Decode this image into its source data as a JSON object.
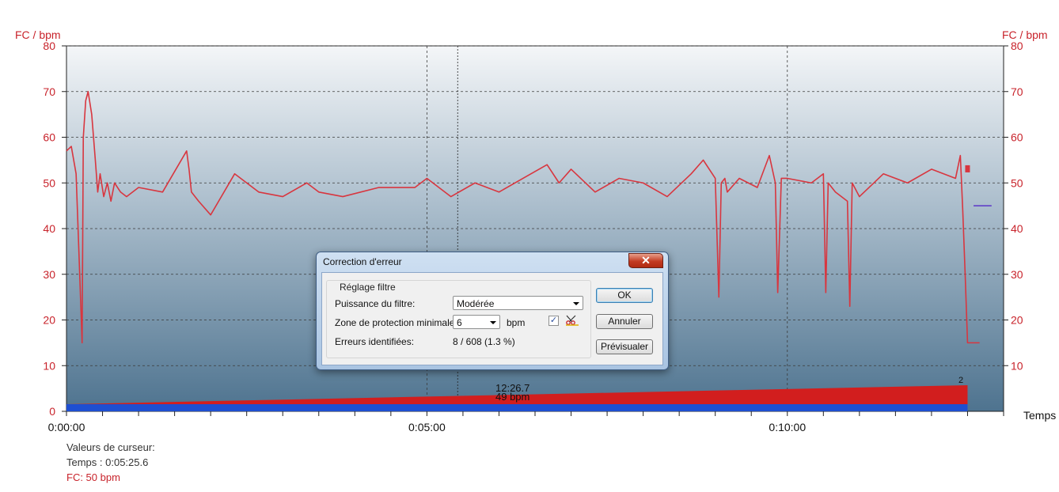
{
  "chart_data": {
    "type": "line",
    "y_axis_label_left": "FC / bpm",
    "y_axis_label_right": "FC / bpm",
    "x_axis_label": "Temps",
    "ylim": [
      0,
      80
    ],
    "y_ticks": [
      0,
      10,
      20,
      30,
      40,
      50,
      60,
      70,
      80
    ],
    "y_ticks_right": [
      10,
      20,
      30,
      40,
      50,
      60,
      70,
      80
    ],
    "x_tick_labels": [
      "0:00:00",
      "0:05:00",
      "0:10:00"
    ],
    "x_tick_seconds": [
      0,
      300,
      600
    ],
    "xlim_seconds": [
      0,
      780
    ],
    "grid": true,
    "series": [
      {
        "color": "#d8363f",
        "x_seconds": [
          0,
          4,
          8,
          11,
          13,
          14,
          16,
          18,
          21,
          24,
          26,
          28,
          31,
          34,
          37,
          40,
          45,
          50,
          60,
          80,
          100,
          102,
          104,
          110,
          120,
          140,
          160,
          180,
          200,
          210,
          230,
          260,
          290,
          300,
          320,
          340,
          360,
          380,
          400,
          410,
          420,
          440,
          460,
          480,
          500,
          520,
          530,
          540,
          543,
          545,
          548,
          550,
          560,
          575,
          585,
          590,
          592,
          595,
          600,
          620,
          630,
          632,
          634,
          640,
          650,
          652,
          654,
          660,
          680,
          700,
          720,
          740,
          744,
          746,
          748,
          750,
          755,
          760
        ],
        "values": [
          57,
          58,
          52,
          30,
          15,
          60,
          68,
          70,
          65,
          55,
          48,
          52,
          47,
          50,
          46,
          50,
          48,
          47,
          49,
          48,
          57,
          53,
          48,
          46,
          43,
          52,
          48,
          47,
          50,
          48,
          47,
          49,
          49,
          51,
          47,
          50,
          48,
          51,
          54,
          50,
          53,
          48,
          51,
          50,
          47,
          52,
          55,
          51,
          25,
          50,
          51,
          48,
          51,
          49,
          56,
          50,
          26,
          51,
          51,
          50,
          52,
          26,
          50,
          48,
          46,
          23,
          50,
          47,
          52,
          50,
          53,
          51,
          56,
          44,
          30,
          15,
          15,
          15
        ]
      },
      {
        "color": "#5b36c8",
        "x_seconds": [
          755,
          760,
          766,
          770
        ],
        "values": [
          45,
          45,
          45,
          45
        ]
      }
    ],
    "cursor_time": "0:05:25.6",
    "cursor_overlay_time": "12:26.7",
    "cursor_overlay_value": "49 bpm",
    "end_marker_label": "2",
    "bottom_bar_progress": [
      0.3,
      1.0
    ]
  },
  "cursor_panel": {
    "title": "Valeurs de curseur:",
    "time": "Temps : 0:05:25.6",
    "hr": "FC: 50 bpm"
  },
  "dialog": {
    "title": "Correction d'erreur",
    "close_label": "✕",
    "group_title": "Réglage filtre",
    "filter_label": "Puissance du filtre:",
    "filter_value": "Modérée",
    "zone_label": "Zone de protection minimale:",
    "zone_value": "6",
    "zone_unit": "bpm",
    "checkbox_checked": true,
    "errors_label": "Erreurs identifiées:",
    "errors_value": "8 / 608 (1.3 %)",
    "ok_label": "OK",
    "cancel_label": "Annuler",
    "preview_label": "Prévisualer"
  }
}
